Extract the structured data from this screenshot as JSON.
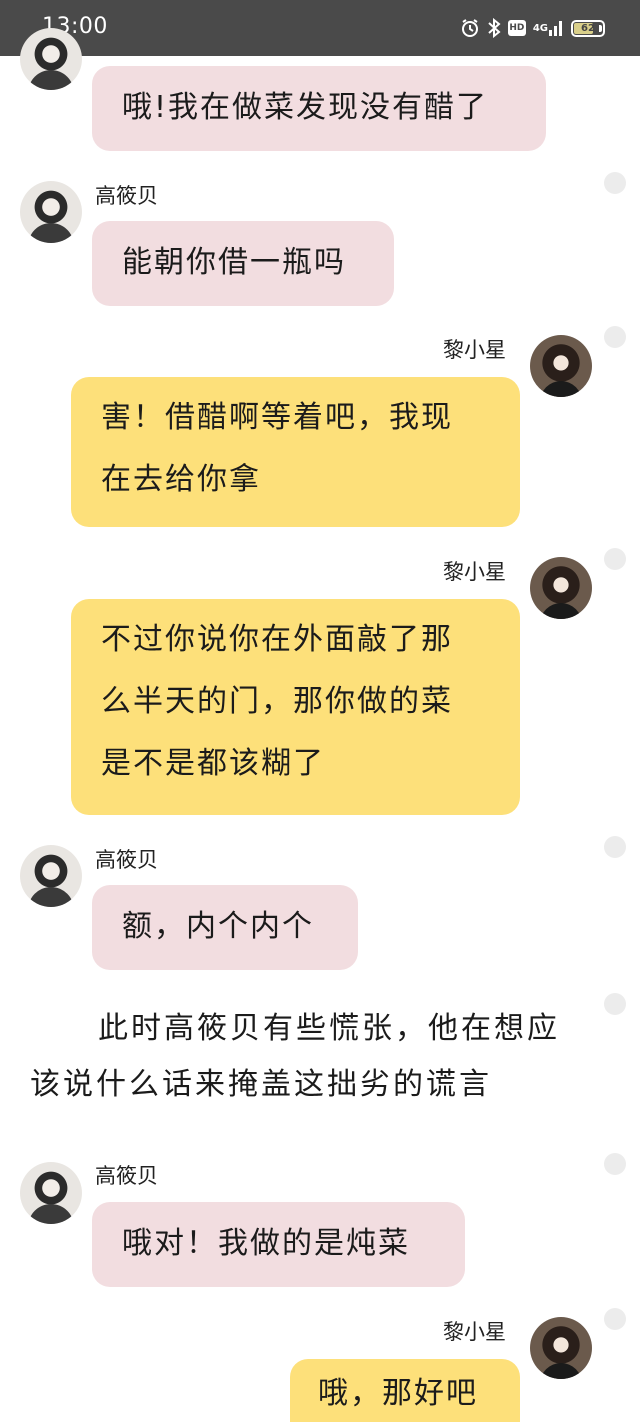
{
  "status_bar": {
    "time": "13:00",
    "icons": [
      "alarm-icon",
      "bluetooth-icon",
      "hd-icon",
      "network-4g-icon",
      "battery-icon"
    ],
    "hd_label": "HD",
    "network_label": "4G",
    "battery_level": "62"
  },
  "messages": [
    {
      "sender": "",
      "side": "left",
      "text": "哦!我在做菜发现没有醋了"
    },
    {
      "sender": "高筱贝",
      "side": "left",
      "text": "能朝你借一瓶吗"
    },
    {
      "sender": "黎小星",
      "side": "right",
      "text_line1": "害！借醋啊等着吧，我现",
      "text_line2": "在去给你拿"
    },
    {
      "sender": "黎小星",
      "side": "right",
      "text_line1": "不过你说你在外面敲了那",
      "text_line2": "么半天的门，那你做的菜",
      "text_line3": "是不是都该糊了"
    },
    {
      "sender": "高筱贝",
      "side": "left",
      "text": "额，内个内个"
    },
    {
      "sender": "高筱贝",
      "side": "left",
      "text": "哦对！我做的是炖菜"
    },
    {
      "sender": "黎小星",
      "side": "right",
      "text": "哦，那好吧"
    }
  ],
  "narration": "此时高筱贝有些慌张，他在想应该说什么话来掩盖这拙劣的谎言",
  "colors": {
    "status_bar": "#4a4a4a",
    "bubble_left": "#f2dde0",
    "bubble_right": "#fde07a",
    "read_dot": "#ececec"
  }
}
